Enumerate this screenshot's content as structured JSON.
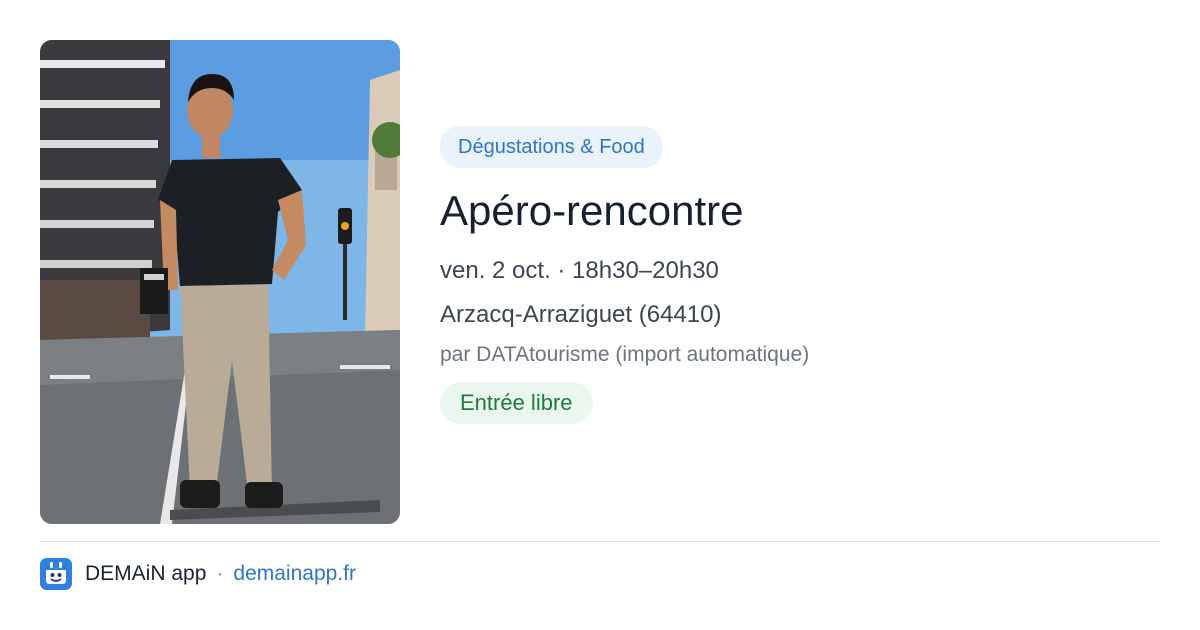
{
  "event": {
    "category": "Dégustations & Food",
    "title": "Apéro-rencontre",
    "datetime": "ven. 2 oct. · 18h30–20h30",
    "location": "Arzacq-Arraziguet (64410)",
    "source": "par DATAtourisme (import automatique)",
    "price": "Entrée libre",
    "image_icon": "event-photo"
  },
  "footer": {
    "app_name": "DEMAiN app",
    "separator": "·",
    "domain": "demainapp.fr",
    "logo_icon": "demain-logo-icon"
  },
  "colors": {
    "category_bg": "#eaf2fc",
    "category_text": "#2f74d0",
    "price_bg": "#eaf7ee",
    "price_text": "#1f7a3d",
    "link": "#2f74d0",
    "logo": "#2d7fe0"
  }
}
